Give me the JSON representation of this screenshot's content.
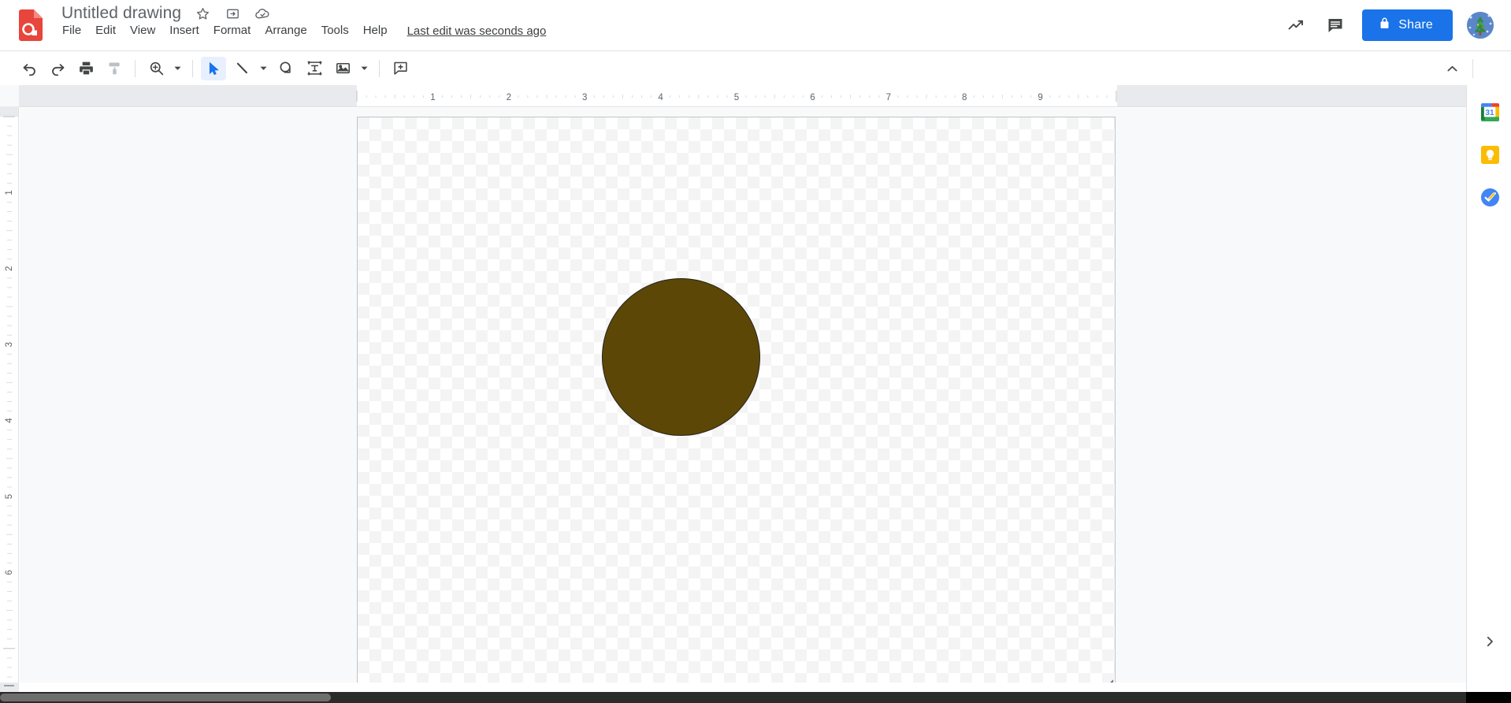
{
  "app": {
    "name": "Google Drawings",
    "accent_color": "#1a73e8",
    "app_icon_color": "#e8453c"
  },
  "header": {
    "doc_title": "Untitled drawing",
    "title_icons": [
      {
        "name": "star-icon",
        "label": "Star"
      },
      {
        "name": "move-to-folder-icon",
        "label": "Move"
      },
      {
        "name": "cloud-saved-icon",
        "label": "See document status"
      }
    ],
    "menu_items": [
      {
        "label": "File"
      },
      {
        "label": "Edit"
      },
      {
        "label": "View"
      },
      {
        "label": "Insert"
      },
      {
        "label": "Format"
      },
      {
        "label": "Arrange"
      },
      {
        "label": "Tools"
      },
      {
        "label": "Help"
      }
    ],
    "last_edit": "Last edit was seconds ago",
    "activity_icon": "trending-up-icon",
    "comment_icon": "comment-icon",
    "share": {
      "label": "Share",
      "icon": "lock-icon",
      "bg_color": "#1a73e8",
      "text_color": "#ffffff"
    },
    "avatar": {
      "name": "user-avatar",
      "alt": "Account"
    }
  },
  "toolbar": {
    "items": [
      {
        "name": "undo-button",
        "label": "Undo",
        "icon": "undo-icon",
        "caret": false,
        "active": false
      },
      {
        "name": "redo-button",
        "label": "Redo",
        "icon": "redo-icon",
        "caret": false,
        "active": false
      },
      {
        "name": "print-button",
        "label": "Print",
        "icon": "print-icon",
        "caret": false,
        "active": false
      },
      {
        "name": "paint-format-button",
        "label": "Paint format",
        "icon": "paint-roller-icon",
        "caret": false,
        "active": false
      },
      {
        "name": "separator-1",
        "label": "",
        "icon": "separator",
        "caret": false,
        "active": false
      },
      {
        "name": "zoom-button",
        "label": "Zoom",
        "icon": "zoom-in-icon",
        "caret": true,
        "active": false
      },
      {
        "name": "separator-2",
        "label": "",
        "icon": "separator",
        "caret": false,
        "active": false
      },
      {
        "name": "select-tool-button",
        "label": "Select",
        "icon": "cursor-arrow-icon",
        "caret": false,
        "active": true
      },
      {
        "name": "line-tool-button",
        "label": "Line",
        "icon": "line-icon",
        "caret": true,
        "active": false
      },
      {
        "name": "shape-tool-button",
        "label": "Shape",
        "icon": "shape-icon",
        "caret": false,
        "active": false
      },
      {
        "name": "text-box-button",
        "label": "Text box",
        "icon": "text-box-icon",
        "caret": false,
        "active": false
      },
      {
        "name": "image-button",
        "label": "Image",
        "icon": "image-icon",
        "caret": true,
        "active": false
      },
      {
        "name": "separator-3",
        "label": "",
        "icon": "separator",
        "caret": false,
        "active": false
      },
      {
        "name": "comment-button",
        "label": "Add comment",
        "icon": "add-comment-icon",
        "caret": false,
        "active": false
      }
    ],
    "collapse_label": "Hide the menus",
    "collapse_icon": "chevron-up-icon"
  },
  "rulers": {
    "unit": "in",
    "horizontal_labels": [
      "1",
      "2",
      "3",
      "4",
      "5",
      "6",
      "7",
      "8",
      "9"
    ],
    "vertical_labels": [
      "1",
      "2",
      "3",
      "4",
      "5",
      "6"
    ]
  },
  "canvas": {
    "background": "transparent-checkerboard",
    "checker_light": "#ffffff",
    "checker_dark": "#f4f4f4",
    "border_color": "#c0c3c7",
    "resize_grip": "resize-handle-icon",
    "shapes": [
      {
        "name": "ellipse-shape",
        "type": "ellipse",
        "fill": "#5c4706",
        "stroke": "#23211c",
        "stroke_width": 1,
        "selected": false
      }
    ]
  },
  "side_panel": {
    "items": [
      {
        "name": "google-calendar-icon",
        "label": "Calendar",
        "badge": "31"
      },
      {
        "name": "google-keep-icon",
        "label": "Keep"
      },
      {
        "name": "google-tasks-icon",
        "label": "Tasks"
      }
    ],
    "expand_label": "Show side panel",
    "expand_icon": "chevron-right-icon"
  }
}
